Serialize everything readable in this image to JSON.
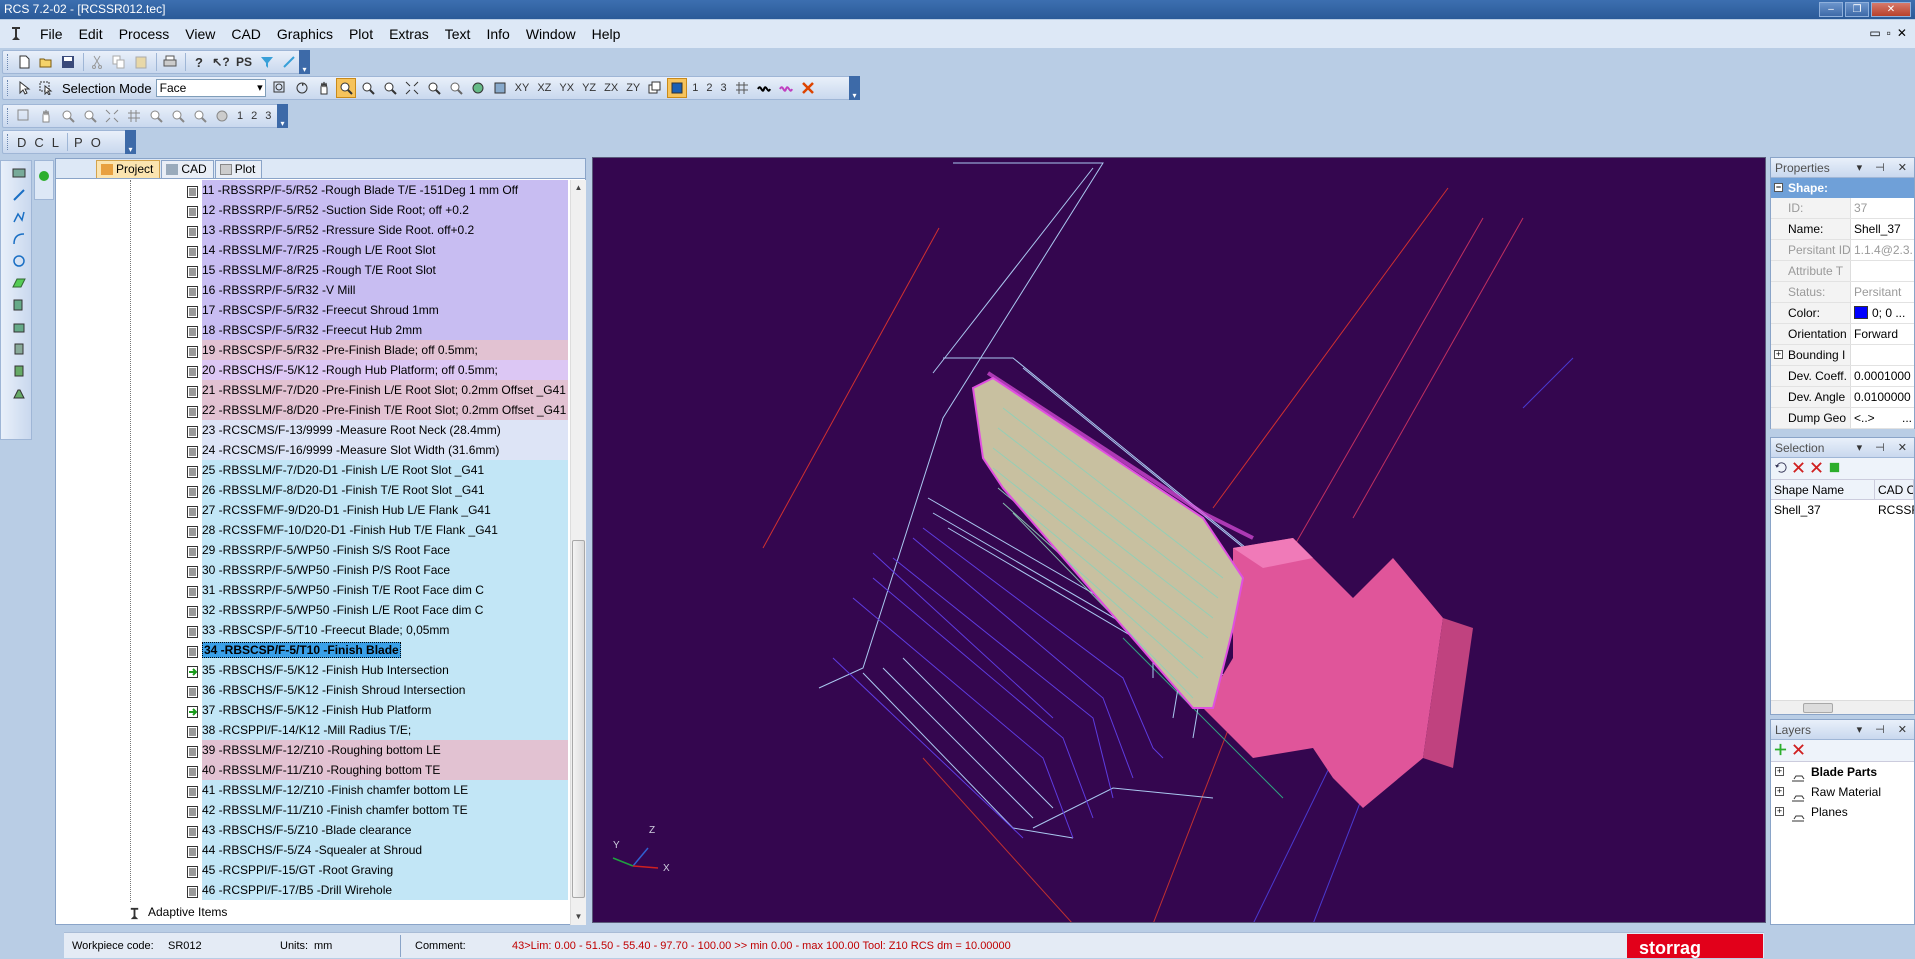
{
  "window": {
    "title": "RCS 7.2-02 - [RCSSR012.tec]"
  },
  "menu": [
    "File",
    "Edit",
    "Process",
    "View",
    "CAD",
    "Graphics",
    "Plot",
    "Extras",
    "Text",
    "Info",
    "Window",
    "Help"
  ],
  "toolbar1": {
    "ps_label": "PS"
  },
  "toolbar2": {
    "selection_mode_label": "Selection Mode",
    "selection_mode_value": "Face",
    "view_buttons": [
      "XY",
      "XZ",
      "YX",
      "YZ",
      "ZX",
      "ZY"
    ],
    "numbers": [
      "1",
      "2",
      "3"
    ]
  },
  "toolbar3": {
    "numbers": [
      "1",
      "2",
      "3"
    ]
  },
  "toolbar4": {
    "letters": [
      "D",
      "C",
      "L",
      "P",
      "O"
    ]
  },
  "tabs": [
    {
      "label": "Project"
    },
    {
      "label": "CAD"
    },
    {
      "label": "Plot"
    }
  ],
  "operations": [
    {
      "text": "11 -RBSSRP/F-5/R52 -Rough Blade T/E  -151Deg 1 mm Off",
      "bg": "#c8bdf2"
    },
    {
      "text": "12 -RBSSRP/F-5/R52 -Suction Side Root; off +0.2",
      "bg": "#c8bdf2"
    },
    {
      "text": "13 -RBSSRP/F-5/R52 -Rressure Side Root. off+0.2",
      "bg": "#c8bdf2"
    },
    {
      "text": "14 -RBSSLM/F-7/R25 -Rough L/E Root Slot",
      "bg": "#c8bdf2"
    },
    {
      "text": "15 -RBSSLM/F-8/R25 -Rough T/E Root Slot",
      "bg": "#c8bdf2"
    },
    {
      "text": "16 -RBSSRP/F-5/R32 -V Mill",
      "bg": "#c8bdf2"
    },
    {
      "text": "17 -RBSCSP/F-5/R32 -Freecut Shroud 1mm",
      "bg": "#c8bdf2"
    },
    {
      "text": "18 -RBSCSP/F-5/R32 -Freecut Hub 2mm",
      "bg": "#c8bdf2"
    },
    {
      "text": "19 -RBSCSP/F-5/R32 -Pre-Finish Blade; off 0.5mm;",
      "bg": "#e2c2d2"
    },
    {
      "text": "20 -RBSCHS/F-5/K12 -Rough Hub Platform; off 0.5mm;",
      "bg": "#dcc7f4"
    },
    {
      "text": "21 -RBSSLM/F-7/D20 -Pre-Finish L/E Root Slot; 0.2mm Offset _G41",
      "bg": "#e2c2d2"
    },
    {
      "text": "22 -RBSSLM/F-8/D20 -Pre-Finish T/E Root Slot; 0.2mm Offset _G41",
      "bg": "#e2c2d2"
    },
    {
      "text": "23 -RCSCMS/F-13/9999 -Measure Root Neck (28.4mm)",
      "bg": "#dde4f6"
    },
    {
      "text": "24 -RCSCMS/F-16/9999 -Measure Slot Width (31.6mm)",
      "bg": "#dde4f6"
    },
    {
      "text": "25 -RBSSLM/F-7/D20-D1 -Finish L/E Root Slot _G41",
      "bg": "#c2e6f6"
    },
    {
      "text": "26 -RBSSLM/F-8/D20-D1 -Finish T/E Root Slot _G41",
      "bg": "#c2e6f6"
    },
    {
      "text": "27 -RCSSFM/F-9/D20-D1 -Finish Hub L/E Flank _G41",
      "bg": "#c2e6f6"
    },
    {
      "text": "28 -RCSSFM/F-10/D20-D1 -Finish Hub T/E Flank _G41",
      "bg": "#c2e6f6"
    },
    {
      "text": "29 -RBSSRP/F-5/WP50 -Finish S/S Root Face",
      "bg": "#c2e6f6"
    },
    {
      "text": "30 -RBSSRP/F-5/WP50 -Finish P/S Root Face",
      "bg": "#c2e6f6"
    },
    {
      "text": "31 -RBSSRP/F-5/WP50 -Finish T/E Root Face dim C",
      "bg": "#c2e6f6"
    },
    {
      "text": "32 -RBSSRP/F-5/WP50 -Finish L/E Root Face dim C",
      "bg": "#c2e6f6"
    },
    {
      "text": "33 -RBSCSP/F-5/T10 -Freecut Blade; 0,05mm",
      "bg": "#c2e6f6"
    },
    {
      "text": "34 -RBSCSP/F-5/T10 -Finish Blade",
      "bg": "#c2e6f6",
      "selected": true
    },
    {
      "text": "35 -RBSCHS/F-5/K12 -Finish Hub Intersection",
      "bg": "#c2e6f6",
      "green": true
    },
    {
      "text": "36 -RBSCHS/F-5/K12 -Finish Shroud Intersection",
      "bg": "#c2e6f6"
    },
    {
      "text": "37 -RBSCHS/F-5/K12 -Finish Hub Platform",
      "bg": "#c2e6f6",
      "green": true
    },
    {
      "text": "38 -RCSPPI/F-14/K12 -Mill Radius T/E;",
      "bg": "#c2e6f6"
    },
    {
      "text": "39 -RBSSLM/F-12/Z10 -Roughing bottom LE",
      "bg": "#e2c2d2"
    },
    {
      "text": "40 -RBSSLM/F-11/Z10 -Roughing bottom TE",
      "bg": "#e2c2d2"
    },
    {
      "text": "41 -RBSSLM/F-12/Z10 -Finish chamfer bottom LE",
      "bg": "#c2e6f6"
    },
    {
      "text": "42 -RBSSLM/F-11/Z10 -Finish chamfer bottom TE",
      "bg": "#c2e6f6"
    },
    {
      "text": "43 -RBSCHS/F-5/Z10 -Blade clearance",
      "bg": "#c2e6f6"
    },
    {
      "text": "44 -RBSCHS/F-5/Z4 -Squealer at Shroud",
      "bg": "#c2e6f6"
    },
    {
      "text": "45 -RCSPPI/F-15/GT -Root Graving",
      "bg": "#c2e6f6"
    },
    {
      "text": "46 -RCSPPI/F-17/B5 -Drill Wirehole",
      "bg": "#c2e6f6"
    }
  ],
  "adaptive_items": "Adaptive Items",
  "axes": {
    "x": "X",
    "y": "Y",
    "z": "Z"
  },
  "properties": {
    "title": "Properties",
    "category": "Shape:",
    "rows": [
      {
        "k": "ID:",
        "v": "37",
        "dim": true
      },
      {
        "k": "Name:",
        "v": "Shell_37"
      },
      {
        "k": "Persitant ID",
        "v": "1.1.4@2.3.",
        "dim": true
      },
      {
        "k": "Attribute T",
        "v": "",
        "dim": true
      },
      {
        "k": "Status:",
        "v": "Persitant",
        "dim": true
      },
      {
        "k": "Color:",
        "v": "0; 0 ...",
        "swatch": "#0000ff"
      },
      {
        "k": "Orientation",
        "v": "Forward"
      },
      {
        "k": "Bounding I",
        "v": "",
        "expand": true
      },
      {
        "k": "Dev. Coeff.",
        "v": "0.0001000"
      },
      {
        "k": "Dev. Angle",
        "v": "0.0100000"
      },
      {
        "k": "Dump Geo",
        "v": "<..>",
        "btn": "..."
      }
    ]
  },
  "selection": {
    "title": "Selection",
    "columns": [
      "Shape Name",
      "CAD O"
    ],
    "rows": [
      [
        "Shell_37",
        "RCSSR"
      ]
    ]
  },
  "layers": {
    "title": "Layers",
    "items": [
      {
        "label": "Blade Parts",
        "bold": true
      },
      {
        "label": "Raw Material"
      },
      {
        "label": "Planes"
      }
    ]
  },
  "status": {
    "workpiece_label": "Workpiece code:",
    "workpiece_value": "SR012",
    "units_label": "Units:",
    "units_value": "mm",
    "comment_label": "Comment:",
    "comment_value": "43>Lim: 0.00 - 51.50 - 55.40 - 97.70 - 100.00 >> min 0.00 - max 100.00      Tool: Z10   RCS dm = 10.00000"
  },
  "brand": "storrag",
  "colors": {
    "viewport_bg": "#34064f",
    "selected_row": "#3aa0e8",
    "accent_pink": "#e0559a"
  }
}
